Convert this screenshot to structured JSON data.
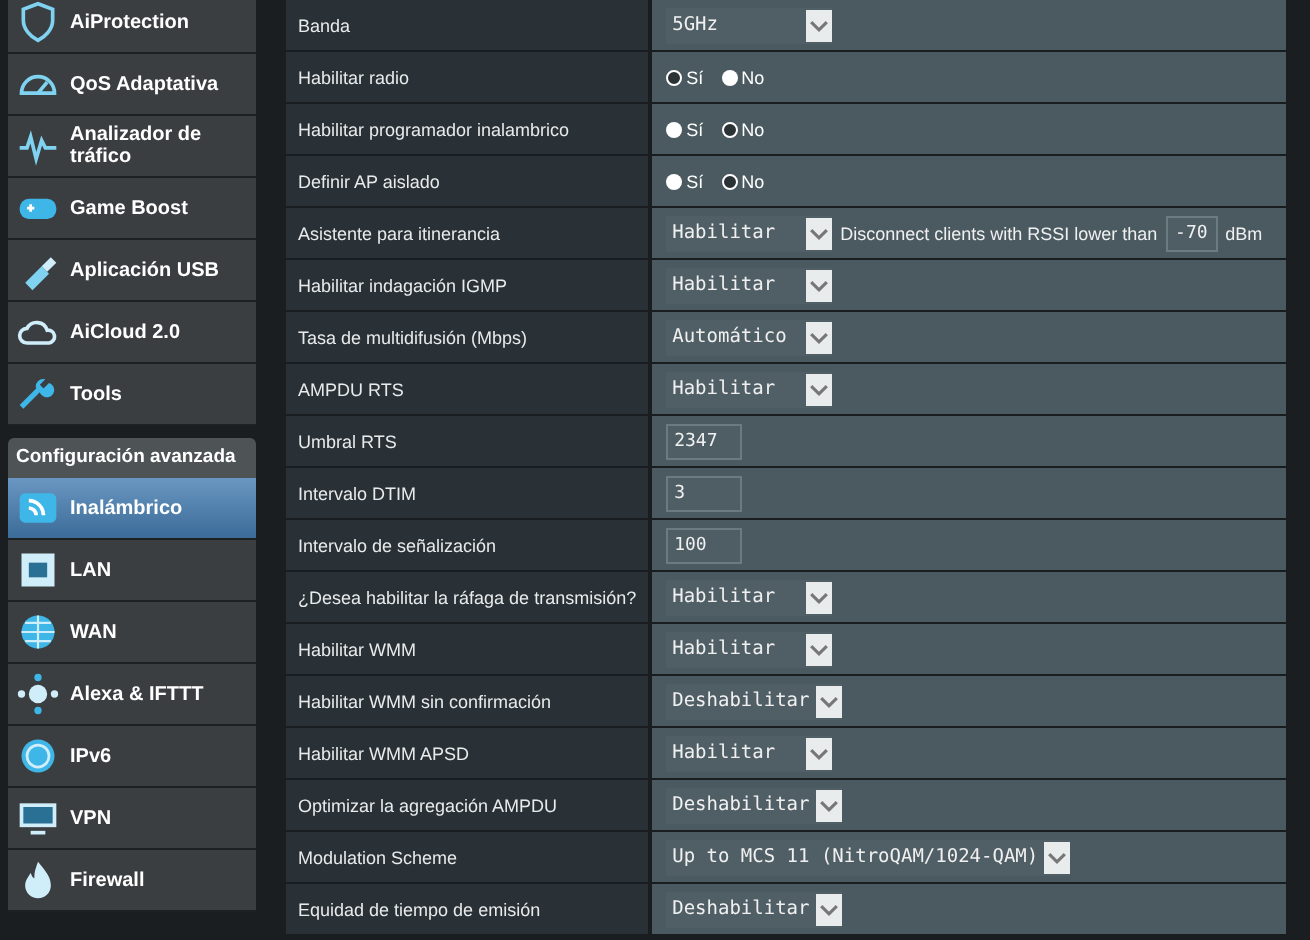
{
  "sidebar": {
    "items": [
      {
        "label": "AiProtection",
        "selected": false
      },
      {
        "label": "QoS Adaptativa",
        "selected": false
      },
      {
        "label": "Analizador de tráfico",
        "selected": false
      },
      {
        "label": "Game Boost",
        "selected": false
      },
      {
        "label": "Aplicación USB",
        "selected": false
      },
      {
        "label": "AiCloud 2.0",
        "selected": false
      },
      {
        "label": "Tools",
        "selected": false
      }
    ],
    "section_title": "Configuración avanzada",
    "advanced_items": [
      {
        "label": "Inalámbrico",
        "selected": true
      },
      {
        "label": "LAN",
        "selected": false
      },
      {
        "label": "WAN",
        "selected": false
      },
      {
        "label": "Alexa & IFTTT",
        "selected": false
      },
      {
        "label": "IPv6",
        "selected": false
      },
      {
        "label": "VPN",
        "selected": false
      },
      {
        "label": "Firewall",
        "selected": false
      }
    ]
  },
  "settings": [
    {
      "label": "Banda",
      "kind": "select",
      "value": "5GHz"
    },
    {
      "label": "Habilitar radio",
      "kind": "radio",
      "options": [
        {
          "label": "Sí",
          "selected": true
        },
        {
          "label": "No",
          "selected": false
        }
      ]
    },
    {
      "label": "Habilitar programador inalambrico",
      "kind": "radio",
      "options": [
        {
          "label": "Sí",
          "selected": false
        },
        {
          "label": "No",
          "selected": true
        }
      ]
    },
    {
      "label": "Definir AP aislado",
      "kind": "radio",
      "options": [
        {
          "label": "Sí",
          "selected": false
        },
        {
          "label": "No",
          "selected": true
        }
      ]
    },
    {
      "label": "Asistente para itinerancia",
      "kind": "roaming",
      "value": "Habilitar",
      "note": "Disconnect clients with RSSI lower than",
      "input": "-70",
      "unit": "dBm"
    },
    {
      "label": "Habilitar indagación IGMP",
      "kind": "select",
      "value": "Habilitar"
    },
    {
      "label": "Tasa de multidifusión (Mbps)",
      "kind": "select",
      "value": "Automático"
    },
    {
      "label": "AMPDU RTS",
      "kind": "select",
      "value": "Habilitar"
    },
    {
      "label": "Umbral RTS",
      "kind": "input",
      "value": "2347"
    },
    {
      "label": "Intervalo DTIM",
      "kind": "input",
      "value": "3"
    },
    {
      "label": "Intervalo de señalización",
      "kind": "input",
      "value": "100"
    },
    {
      "label": "¿Desea habilitar la ráfaga de transmisión?",
      "kind": "select",
      "value": "Habilitar"
    },
    {
      "label": "Habilitar WMM",
      "kind": "select",
      "value": "Habilitar"
    },
    {
      "label": "Habilitar WMM sin confirmación",
      "kind": "select",
      "value": "Deshabilitar"
    },
    {
      "label": "Habilitar WMM APSD",
      "kind": "select",
      "value": "Habilitar"
    },
    {
      "label": "Optimizar la agregación AMPDU",
      "kind": "select",
      "value": "Deshabilitar"
    },
    {
      "label": "Modulation Scheme",
      "kind": "select",
      "value": "Up to MCS 11 (NitroQAM/1024-QAM)"
    },
    {
      "label": "Equidad de tiempo de emisión",
      "kind": "select",
      "value": "Deshabilitar"
    }
  ]
}
